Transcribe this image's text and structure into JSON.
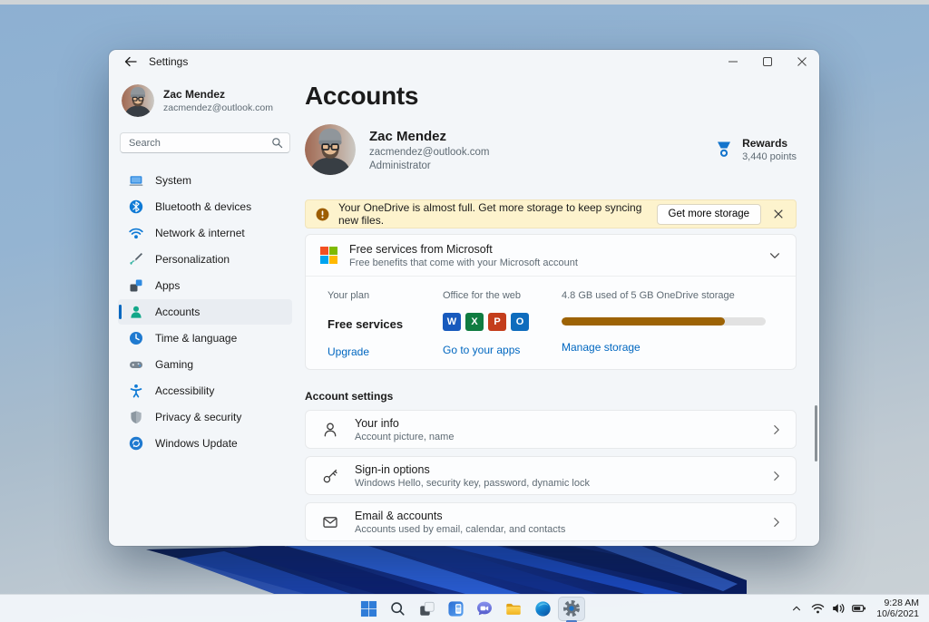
{
  "colors": {
    "accent": "#0067c0",
    "link_blue": "#0067c0",
    "banner_bg": "#fdf3cd",
    "warning_amber": "#9d5d00",
    "progress_fill": "#9d6305",
    "progress_track": "#e2e2e2",
    "ms_logo": [
      "#f25022",
      "#7fba00",
      "#00a4ef",
      "#ffb900"
    ],
    "selected_nav_bg": "#e9edf2"
  },
  "window": {
    "titlebar": {
      "title": "Settings"
    },
    "sidebar": {
      "user": {
        "name": "Zac Mendez",
        "email": "zacmendez@outlook.com"
      },
      "search_placeholder": "Search",
      "items": [
        {
          "label": "System"
        },
        {
          "label": "Bluetooth & devices"
        },
        {
          "label": "Network & internet"
        },
        {
          "label": "Personalization"
        },
        {
          "label": "Apps"
        },
        {
          "label": "Accounts",
          "selected": true
        },
        {
          "label": "Time & language"
        },
        {
          "label": "Gaming"
        },
        {
          "label": "Accessibility"
        },
        {
          "label": "Privacy & security"
        },
        {
          "label": "Windows Update"
        }
      ]
    },
    "main": {
      "page_title": "Accounts",
      "profile": {
        "name": "Zac Mendez",
        "email": "zacmendez@outlook.com",
        "role": "Administrator"
      },
      "rewards": {
        "label": "Rewards",
        "points": "3,440 points"
      },
      "banner": {
        "message": "Your OneDrive is almost full. Get more storage to keep syncing new files.",
        "button_label": "Get more storage"
      },
      "services_card": {
        "title": "Free services from Microsoft",
        "subtitle": "Free benefits that come with your Microsoft account",
        "plan": {
          "label": "Your plan",
          "value": "Free services",
          "link": "Upgrade"
        },
        "office": {
          "label": "Office for the web",
          "apps": [
            {
              "name": "Word",
              "letter": "W",
              "color": "#185abd"
            },
            {
              "name": "Excel",
              "letter": "X",
              "color": "#107c41"
            },
            {
              "name": "PowerPoint",
              "letter": "P",
              "color": "#c43e1c"
            },
            {
              "name": "Outlook",
              "letter": "O",
              "color": "#0f6cbd"
            }
          ],
          "link": "Go to your apps"
        },
        "storage": {
          "label": "4.8 GB used of 5 GB OneDrive storage",
          "used_pct": 80,
          "link": "Manage storage"
        }
      },
      "account_settings": {
        "header": "Account settings",
        "rows": [
          {
            "title": "Your info",
            "subtitle": "Account picture, name"
          },
          {
            "title": "Sign-in options",
            "subtitle": "Windows Hello, security key, password, dynamic lock"
          },
          {
            "title": "Email & accounts",
            "subtitle": "Accounts used by email, calendar, and contacts"
          }
        ]
      }
    }
  },
  "taskbar": {
    "apps": [
      "Start",
      "Search",
      "Task view",
      "Widgets",
      "Chat",
      "File Explorer",
      "Microsoft Edge",
      "Settings"
    ],
    "active_app": "Settings",
    "tray": {
      "time": "9:28 AM",
      "date": "10/6/2021"
    }
  }
}
